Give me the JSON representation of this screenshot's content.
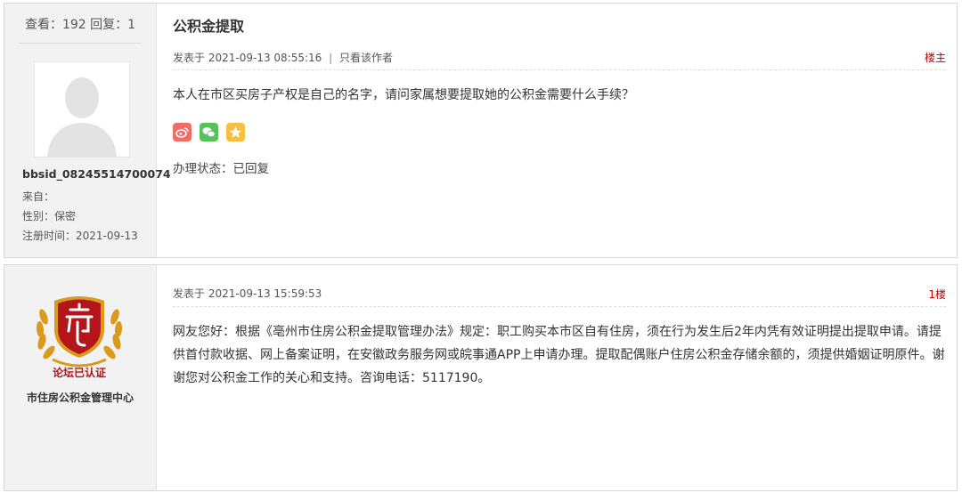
{
  "question": {
    "stats": "查看：192 回复：1",
    "title": "公积金提取",
    "posted_label": "发表于",
    "posted_time": "2021-09-13 08:55:16",
    "separator": "|",
    "author_only": "只看该作者",
    "floor_label": "楼主",
    "content": "本人在市区买房子产权是自己的名字，请问家属想要提取她的公积金需要什么手续？",
    "share_icons": [
      "weibo-icon",
      "wechat-icon",
      "favorite-icon"
    ],
    "status": "办理状态：已回复",
    "user": {
      "name": "bbsid_08245514700074",
      "from": "来自：",
      "gender": "性别：保密",
      "registered": "注册时间：2021-09-13"
    }
  },
  "reply": {
    "posted_label": "发表于",
    "posted_time": "2021-09-13 15:59:53",
    "floor_label": "1楼",
    "content": "网友您好：根据《亳州市住房公积金提取管理办法》规定：职工购买本市区自有住房，须在行为发生后2年内凭有效证明提出提取申请。请提供首付款收据、网上备案证明，在安徽政务服务网或皖事通APP上申请办理。提取配偶账户住房公积金存储余额的，须提供婚姻证明原件。谢谢您对公积金工作的关心和支持。咨询电话：5117190。",
    "badge_text": "论坛已认证",
    "org_name": "市住房公积金管理中心"
  },
  "colors": {
    "floor_red": "#c00000",
    "badge_red": "#b3151b",
    "badge_gold": "#d99a1e"
  }
}
